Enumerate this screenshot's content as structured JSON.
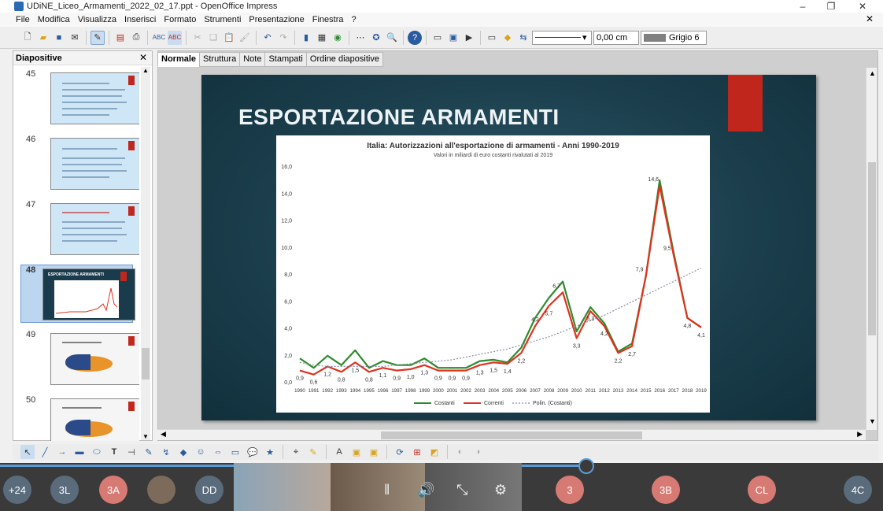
{
  "window": {
    "title": "UDiNE_Liceo_Armamenti_2022_02_17.ppt - OpenOffice Impress"
  },
  "menu": [
    "File",
    "Modifica",
    "Visualizza",
    "Inserisci",
    "Formato",
    "Strumenti",
    "Presentazione",
    "Finestra",
    "?"
  ],
  "toolbar": {
    "line_width": "0,00 cm",
    "fill_color": "Grigio 6"
  },
  "slides_panel": {
    "title": "Diapositive",
    "slides": [
      {
        "number": "45"
      },
      {
        "number": "46"
      },
      {
        "number": "47"
      },
      {
        "number": "48",
        "selected": true,
        "thumb_title": "ESPORTAZIONE ARMAMENTI"
      },
      {
        "number": "49"
      },
      {
        "number": "50"
      }
    ]
  },
  "view_tabs": [
    "Normale",
    "Struttura",
    "Note",
    "Stampati",
    "Ordine diapositive"
  ],
  "slide": {
    "title": "ESPORTAZIONE ARMAMENTI"
  },
  "chart_data": {
    "type": "line",
    "title": "Italia: Autorizzazioni all'esportazione di armamenti - Anni 1990-2019",
    "subtitle": "Valori in miliardi di euro costanti rivalutati al 2019",
    "xlabel": "",
    "ylabel": "",
    "ylim": [
      0,
      16
    ],
    "yticks": [
      "0,0",
      "2,0",
      "4,0",
      "6,0",
      "8,0",
      "10,0",
      "12,0",
      "14,0",
      "16,0"
    ],
    "x": [
      "1990",
      "1991",
      "1992",
      "1993",
      "1994",
      "1995",
      "1996",
      "1997",
      "1998",
      "1999",
      "2000",
      "2001",
      "2002",
      "2003",
      "2004",
      "2005",
      "2006",
      "2007",
      "2008",
      "2009",
      "2010",
      "2011",
      "2012",
      "2013",
      "2014",
      "2015",
      "2016",
      "2017",
      "2018",
      "2019"
    ],
    "series": [
      {
        "name": "Costanti",
        "color": "#2e8b2e",
        "values": [
          1.8,
          1.1,
          2.0,
          1.3,
          2.4,
          1.1,
          1.6,
          1.3,
          1.3,
          1.8,
          1.1,
          1.1,
          1.1,
          1.6,
          1.7,
          1.5,
          2.6,
          4.8,
          6.3,
          7.5,
          3.8,
          5.6,
          4.4,
          2.3,
          2.9,
          7.9,
          15.0,
          9.7,
          4.8,
          4.1
        ]
      },
      {
        "name": "Correnti",
        "color": "#e0321e",
        "values": [
          0.9,
          0.6,
          1.2,
          0.8,
          1.5,
          0.8,
          1.1,
          0.9,
          1.0,
          1.3,
          0.9,
          0.9,
          0.9,
          1.3,
          1.5,
          1.4,
          2.2,
          4.2,
          5.7,
          6.7,
          3.3,
          5.3,
          4.2,
          2.2,
          2.7,
          7.9,
          14.6,
          9.5,
          4.8,
          4.1
        ]
      },
      {
        "name": "Polin. (Costanti)",
        "color": "#8a8aa8",
        "dashed": true,
        "values": [
          1.5,
          1.3,
          1.2,
          1.2,
          1.2,
          1.2,
          1.2,
          1.3,
          1.4,
          1.5,
          1.6,
          1.7,
          1.9,
          2.1,
          2.3,
          2.5,
          2.8,
          3.1,
          3.4,
          3.8,
          4.2,
          4.6,
          5.0,
          5.5,
          6.0,
          6.5,
          7.0,
          7.5,
          8.0,
          8.5
        ]
      }
    ],
    "data_labels": [
      {
        "x": "1990",
        "text": "0,9"
      },
      {
        "x": "1991",
        "text": "0,6"
      },
      {
        "x": "1992",
        "text": "1,2"
      },
      {
        "x": "1993",
        "text": "0,8"
      },
      {
        "x": "1994",
        "text": "1,5"
      },
      {
        "x": "1995",
        "text": "0,8"
      },
      {
        "x": "1996",
        "text": "1,1"
      },
      {
        "x": "1997",
        "text": "0,9"
      },
      {
        "x": "1998",
        "text": "1,0"
      },
      {
        "x": "1999",
        "text": "1,3"
      },
      {
        "x": "2000",
        "text": "0,9"
      },
      {
        "x": "2001",
        "text": "0,9"
      },
      {
        "x": "2002",
        "text": "0,9"
      },
      {
        "x": "2003",
        "text": "1,3"
      },
      {
        "x": "2004",
        "text": "1,5"
      },
      {
        "x": "2005",
        "text": "1,4"
      },
      {
        "x": "2006",
        "text": "2,2"
      },
      {
        "x": "2007",
        "text": "4,2"
      },
      {
        "x": "2008",
        "text": "5,7"
      },
      {
        "x": "2009",
        "text": "6,7"
      },
      {
        "x": "2010",
        "text": "3,3"
      },
      {
        "x": "2011",
        "text": "5,3"
      },
      {
        "x": "2012",
        "text": "4,2"
      },
      {
        "x": "2013",
        "text": "2,2"
      },
      {
        "x": "2014",
        "text": "2,7"
      },
      {
        "x": "2015",
        "text": "7,9"
      },
      {
        "x": "2016",
        "text": "14,6"
      },
      {
        "x": "2017",
        "text": "9,5"
      },
      {
        "x": "2018",
        "text": "4,8"
      },
      {
        "x": "2019",
        "text": "4,1"
      }
    ],
    "legend": "bottom"
  },
  "meeting": {
    "participants": [
      {
        "label": "+24",
        "color": "#5a6b7c"
      },
      {
        "label": "3L",
        "color": "#5a6b7c"
      },
      {
        "label": "3A",
        "color": "#d77a74"
      },
      {
        "label": "DD",
        "color": "#5a6b7c"
      },
      {
        "label": "3",
        "color": "#d77a74"
      },
      {
        "label": "3B",
        "color": "#d77a74"
      },
      {
        "label": "CL",
        "color": "#d77a74"
      },
      {
        "label": "4C",
        "color": "#5a6b7c"
      }
    ]
  }
}
